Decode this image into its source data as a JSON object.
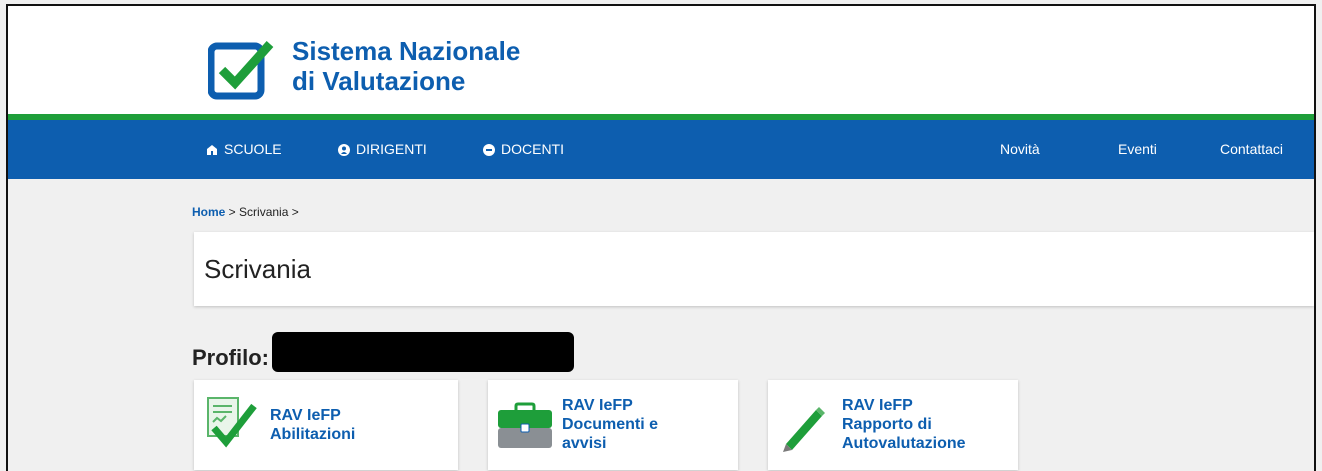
{
  "header": {
    "logo_line1": "Sistema Nazionale",
    "logo_line2": "di Valutazione",
    "logo_icon": "checkbox-check-icon"
  },
  "nav": {
    "left": [
      {
        "label": "SCUOLE",
        "icon": "school-icon"
      },
      {
        "label": "DIRIGENTI",
        "icon": "person-icon"
      },
      {
        "label": "DOCENTI",
        "icon": "teacher-icon"
      }
    ],
    "right": [
      {
        "label": "Novità"
      },
      {
        "label": "Eventi"
      },
      {
        "label": "Contattaci"
      }
    ]
  },
  "breadcrumb": {
    "home": "Home",
    "sep1": " > ",
    "current": "Scrivania",
    "sep2": " >"
  },
  "page": {
    "title": "Scrivania",
    "profile_label": "Profilo:"
  },
  "tiles": [
    {
      "line1": "RAV IeFP",
      "line2": "Abilitazioni",
      "line3": "",
      "icon": "checklist-icon"
    },
    {
      "line1": "RAV IeFP",
      "line2": "Documenti e",
      "line3": "avvisi",
      "icon": "briefcase-icon"
    },
    {
      "line1": "RAV IeFP",
      "line2": "Rapporto di",
      "line3": "Autovalutazione",
      "icon": "pencil-icon"
    }
  ],
  "colors": {
    "brand_blue": "#0d5eaf",
    "accent_green": "#1e9e3a"
  }
}
